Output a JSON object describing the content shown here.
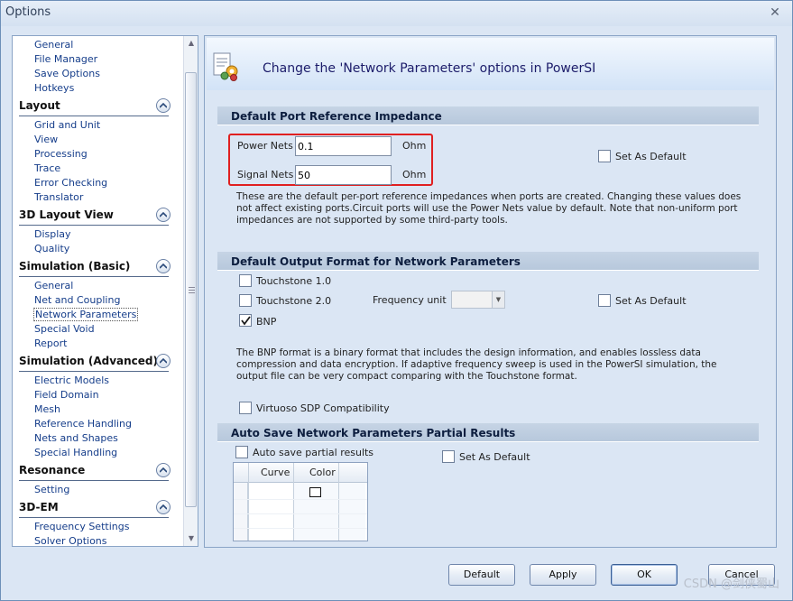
{
  "window": {
    "title": "Options"
  },
  "nav": {
    "general_items": [
      "General",
      "File Manager",
      "Save Options",
      "Hotkeys"
    ],
    "groups": [
      {
        "title": "Layout",
        "items": [
          "Grid and Unit",
          "View",
          "Processing",
          "Trace",
          "Error Checking",
          "Translator"
        ]
      },
      {
        "title": "3D Layout View",
        "items": [
          "Display",
          "Quality"
        ]
      },
      {
        "title": "Simulation (Basic)",
        "items": [
          "General",
          "Net and Coupling",
          "Network Parameters",
          "Special Void",
          "Report"
        ]
      },
      {
        "title": "Simulation (Advanced)",
        "items": [
          "Electric Models",
          "Field Domain",
          "Mesh",
          "Reference Handling",
          "Nets and Shapes",
          "Special Handling"
        ]
      },
      {
        "title": "Resonance",
        "items": [
          "Setting"
        ]
      },
      {
        "title": "3D-EM",
        "items": [
          "Frequency Settings",
          "Solver Options"
        ]
      }
    ],
    "selected": "Network Parameters"
  },
  "banner": {
    "text": "Change the 'Network Parameters' options in PowerSI"
  },
  "port_impedance": {
    "heading": "Default Port Reference Impedance",
    "power_label": "Power Nets",
    "power_value": "0.1",
    "power_unit": "Ohm",
    "signal_label": "Signal Nets",
    "signal_value": "50",
    "signal_unit": "Ohm",
    "set_default": "Set As Default",
    "set_default_checked": false,
    "description": "These are the default per-port reference impedances when ports are created.  Changing these values does not affect existing ports.Circuit ports will use the Power Nets value by default. Note that non-uniform port impedances are not supported by some third-party tools."
  },
  "output_format": {
    "heading": "Default Output Format for Network Parameters",
    "touchstone1": "Touchstone 1.0",
    "touchstone1_checked": false,
    "touchstone2": "Touchstone 2.0",
    "touchstone2_checked": false,
    "frequency_unit_label": "Frequency unit",
    "frequency_unit_value": "",
    "bnp": "BNP",
    "bnp_checked": true,
    "set_default": "Set As Default",
    "set_default_checked": false,
    "description": "The BNP format is a binary format that includes the design information, and enables lossless data compression and data encryption. If adaptive frequency sweep is used in the PowerSI simulation, the output file can be very compact comparing with the Touchstone format.",
    "virtuoso": "Virtuoso SDP Compatibility",
    "virtuoso_checked": false
  },
  "auto_save": {
    "heading": "Auto Save Network Parameters Partial Results",
    "auto_save_label": "Auto save partial results",
    "auto_save_checked": false,
    "set_default": "Set As Default",
    "set_default_checked": false,
    "columns": [
      "Curve",
      "Color"
    ]
  },
  "buttons": {
    "default": "Default",
    "apply": "Apply",
    "ok": "OK",
    "cancel": "Cancel"
  },
  "watermark": "CSDN @剑侠蜀山",
  "colors": {
    "highlight_box": "#e02020",
    "section_header": "#c6d4e5",
    "window_bg": "#dbe6f4"
  }
}
